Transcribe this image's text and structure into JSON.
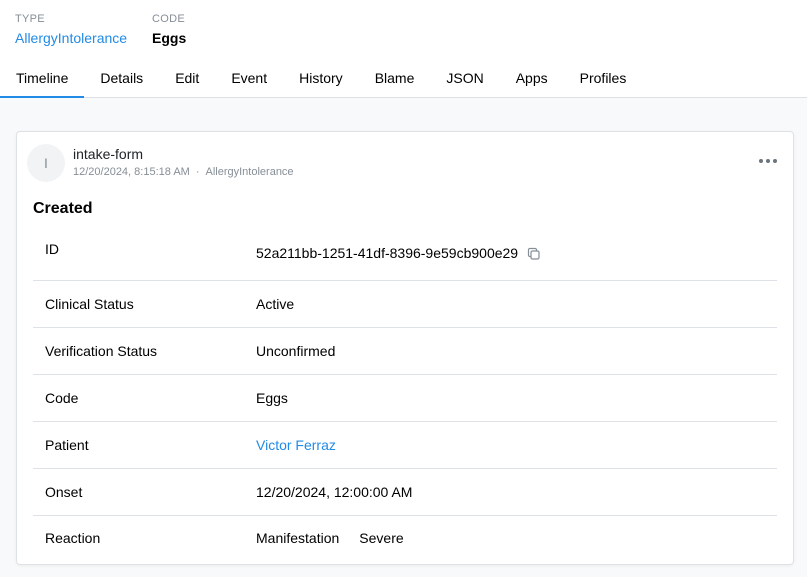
{
  "header": {
    "type_label": "TYPE",
    "type_value": "AllergyIntolerance",
    "code_label": "CODE",
    "code_value": "Eggs"
  },
  "tabs": [
    {
      "label": "Timeline",
      "active": true
    },
    {
      "label": "Details"
    },
    {
      "label": "Edit"
    },
    {
      "label": "Event"
    },
    {
      "label": "History"
    },
    {
      "label": "Blame"
    },
    {
      "label": "JSON"
    },
    {
      "label": "Apps"
    },
    {
      "label": "Profiles"
    }
  ],
  "entry": {
    "avatar_initial": "I",
    "author": "intake-form",
    "timestamp": "12/20/2024, 8:15:18 AM",
    "separator": "·",
    "resource_type": "AllergyIntolerance",
    "section_title": "Created",
    "menu_icon": "more-horizontal-icon",
    "fields": {
      "id": {
        "label": "ID",
        "value": "52a211bb-1251-41df-8396-9e59cb900e29"
      },
      "clinical_status": {
        "label": "Clinical Status",
        "value": "Active"
      },
      "verification_status": {
        "label": "Verification Status",
        "value": "Unconfirmed"
      },
      "code": {
        "label": "Code",
        "value": "Eggs"
      },
      "patient": {
        "label": "Patient",
        "value": "Victor Ferraz"
      },
      "onset": {
        "label": "Onset",
        "value": "12/20/2024, 12:00:00 AM"
      },
      "reaction": {
        "label": "Reaction",
        "manifestation": "Manifestation",
        "severity": "Severe"
      }
    }
  },
  "colors": {
    "accent": "#228be6",
    "muted": "#868e96",
    "border": "#dee2e6"
  }
}
